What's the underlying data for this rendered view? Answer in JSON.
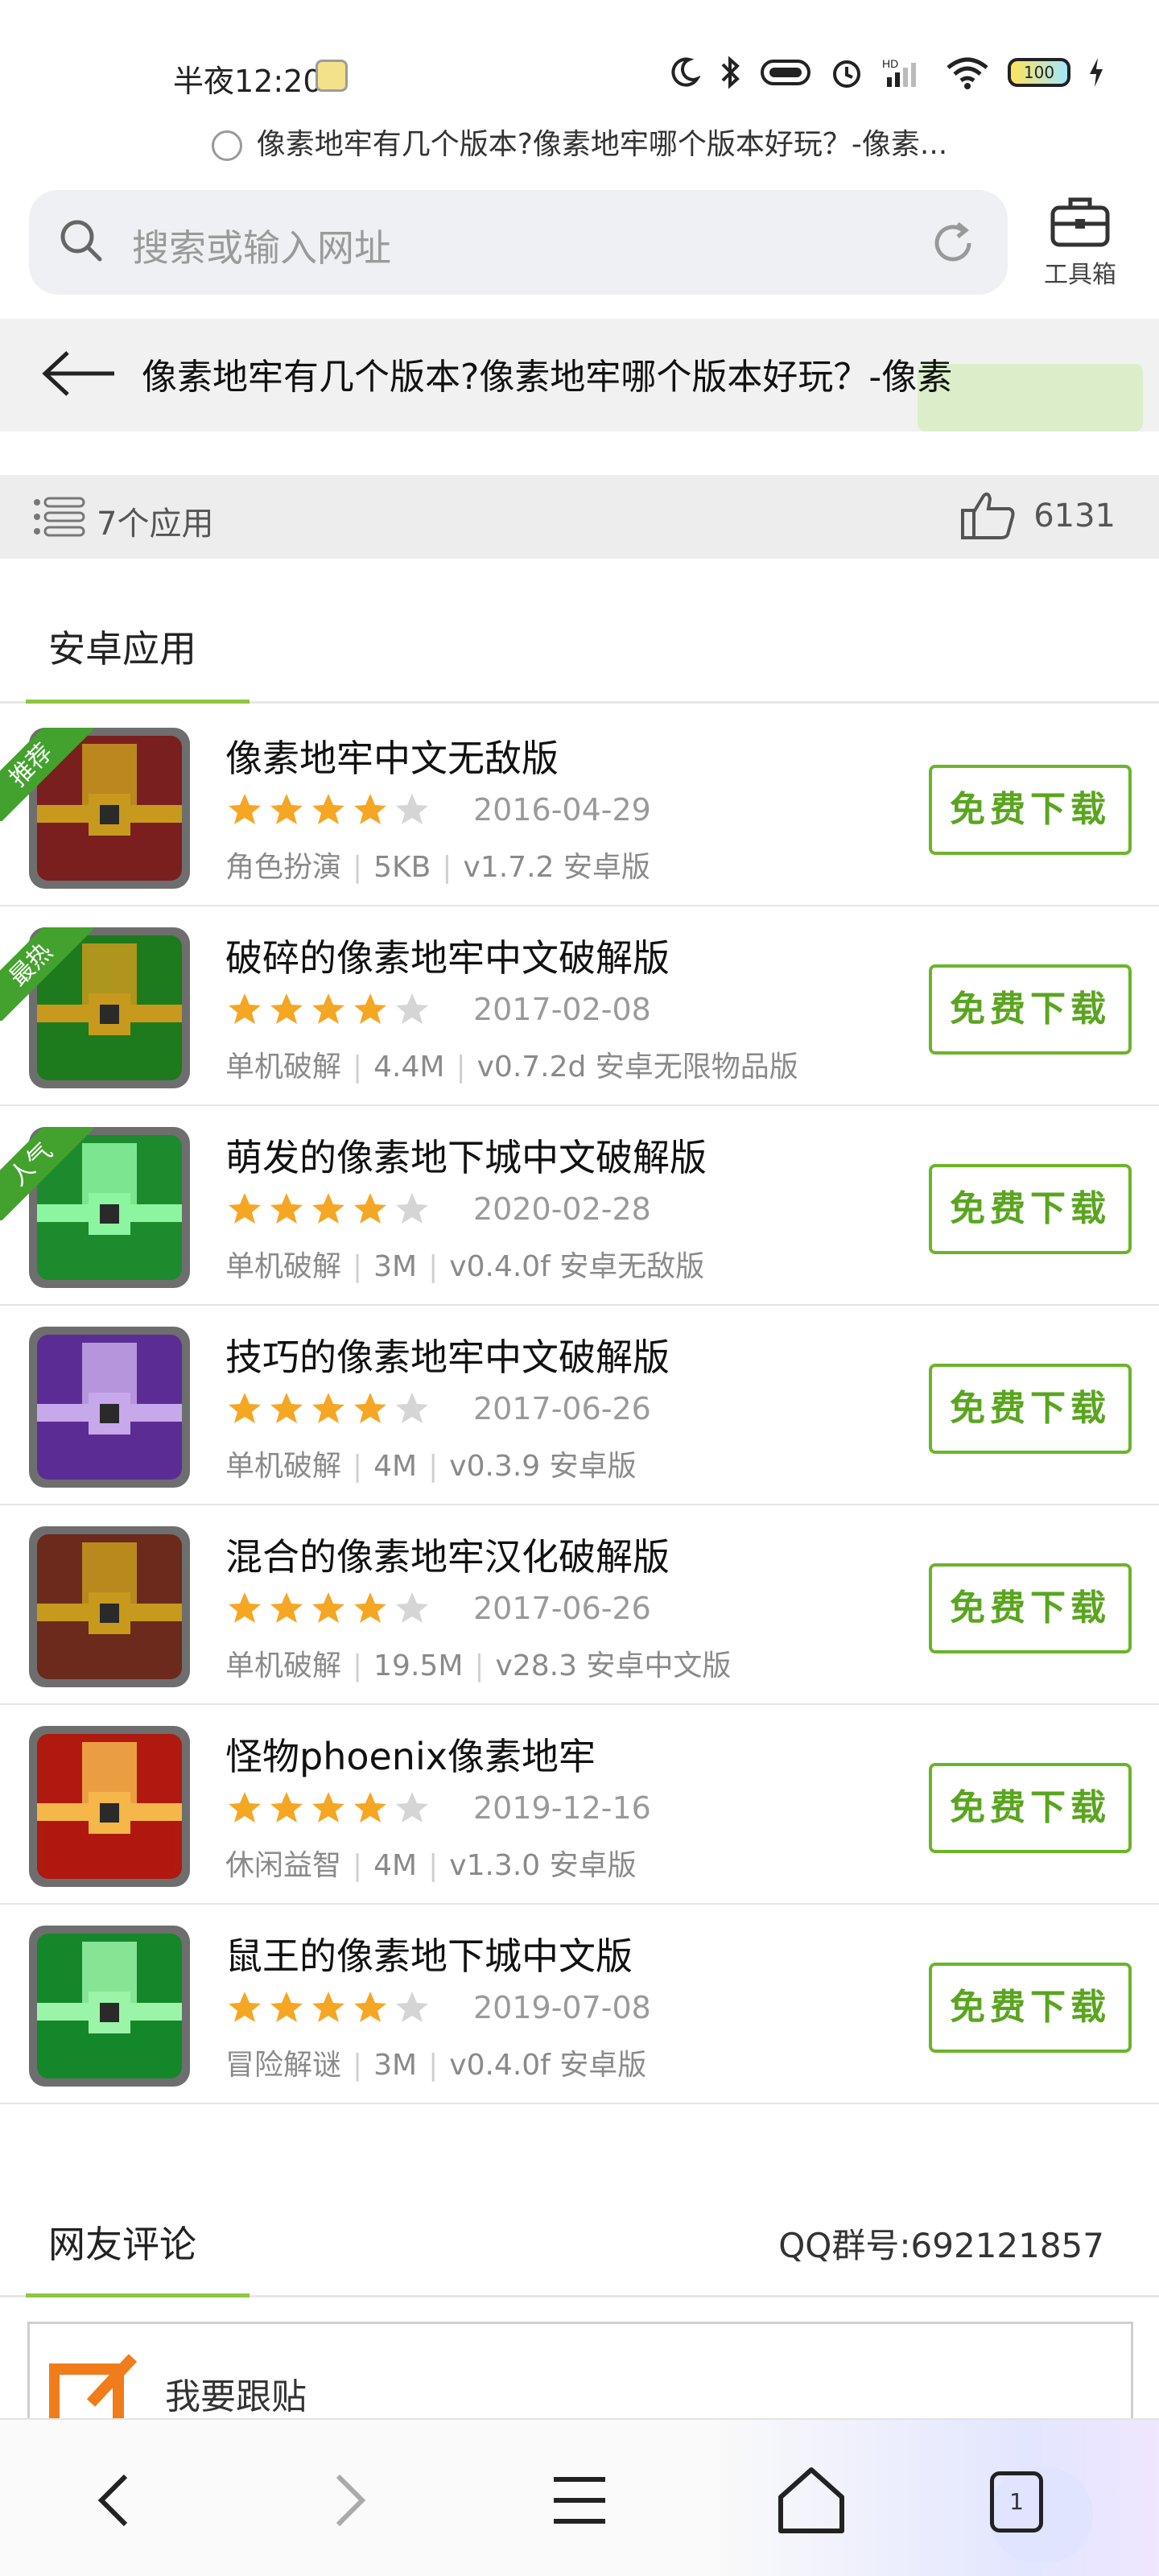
{
  "status_bar": {
    "time": "半夜12:20",
    "icons": [
      "moon-icon",
      "bluetooth-icon",
      "nfc-icon",
      "alarm-icon",
      "signal-icon",
      "wifi-icon",
      "battery-icon",
      "charging-icon"
    ],
    "battery": "100"
  },
  "page_url_title": "像素地牢有几个版本?像素地牢哪个版本好玩？-像素...",
  "search": {
    "placeholder": "搜索或输入网址"
  },
  "toolbox_label": "工具箱",
  "header": {
    "title": "像素地牢有几个版本?像素地牢哪个版本好玩？-像素"
  },
  "info": {
    "app_count": "7个应用",
    "likes": "6131"
  },
  "tab_label": "安卓应用",
  "download_label": "免费下载",
  "apps": [
    {
      "name": "像素地牢中文无敌版",
      "rating": 4,
      "date": "2016-04-29",
      "category": "角色扮演",
      "size": "5KB",
      "version": "v1.7.2 安卓版",
      "badge": "推荐",
      "icon_colors": [
        "#7a1f1f",
        "#c79a1e"
      ]
    },
    {
      "name": "破碎的像素地牢中文破解版",
      "rating": 4,
      "date": "2017-02-08",
      "category": "单机破解",
      "size": "4.4M",
      "version": "v0.7.2d 安卓无限物品版",
      "badge": "最热",
      "icon_colors": [
        "#1d7a1d",
        "#c79a1e"
      ]
    },
    {
      "name": "萌发的像素地下城中文破解版",
      "rating": 4,
      "date": "2020-02-28",
      "category": "单机破解",
      "size": "3M",
      "version": "v0.4.0f 安卓无敌版",
      "badge": "人气",
      "icon_colors": [
        "#1e8a2e",
        "#8cf5a0"
      ]
    },
    {
      "name": "技巧的像素地牢中文破解版",
      "rating": 4,
      "date": "2017-06-26",
      "category": "单机破解",
      "size": "4M",
      "version": "v0.3.9 安卓版",
      "badge": "",
      "icon_colors": [
        "#5b2d94",
        "#c7a8ea"
      ]
    },
    {
      "name": "混合的像素地牢汉化破解版",
      "rating": 4,
      "date": "2017-06-26",
      "category": "单机破解",
      "size": "19.5M",
      "version": "v28.3 安卓中文版",
      "badge": "",
      "icon_colors": [
        "#6b2a1c",
        "#c79a1e"
      ]
    },
    {
      "name": "怪物phoenix像素地牢",
      "rating": 4,
      "date": "2019-12-16",
      "category": "休闲益智",
      "size": "4M",
      "version": "v1.3.0 安卓版",
      "badge": "",
      "icon_colors": [
        "#b0190f",
        "#f5b64a"
      ]
    },
    {
      "name": "鼠王的像素地下城中文版",
      "rating": 4,
      "date": "2019-07-08",
      "category": "冒险解谜",
      "size": "3M",
      "version": "v0.4.0f 安卓版",
      "badge": "",
      "icon_colors": [
        "#14872a",
        "#9af5a8"
      ]
    }
  ],
  "comments": {
    "title": "网友评论",
    "qq_group": "QQ群号:692121857",
    "post_label": "我要跟贴"
  },
  "bottom_nav": {
    "tab_count": "1"
  },
  "colors": {
    "accent_green": "#6bb42a",
    "star_gold": "#f5a623",
    "badge_green": "#43a22d"
  }
}
